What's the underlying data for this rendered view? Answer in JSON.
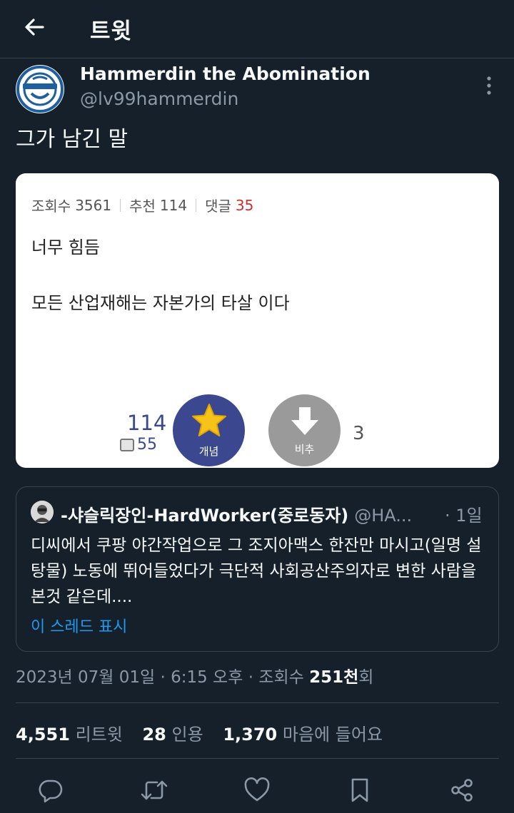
{
  "header": {
    "title": "트윗"
  },
  "author": {
    "name": "Hammerdin the Abomination",
    "handle": "@lv99hammerdin"
  },
  "tweet": {
    "text": "그가 남긴 말"
  },
  "embed": {
    "views_label": "조회수",
    "views": "3561",
    "recommend_label": "추천",
    "recommend": "114",
    "comments_label": "댓글",
    "comments": "35",
    "line1": "너무 힘듬",
    "line2": "모든 산업재해는 자본가의 타살 이다",
    "up_count": "114",
    "fix_count": "55",
    "up_label": "개념",
    "down_label": "비추",
    "down_count": "3",
    "colors": {
      "up_button": "#3b4890",
      "down_button": "#9a9a9a",
      "star": "#f6c419",
      "comments": "#d1302a"
    }
  },
  "quote": {
    "name": "-샤슬릭장인-HardWorker(중로동자)",
    "handle": "@HA...",
    "time": "· 1일",
    "body": "디씨에서 쿠팡 야간작업으로 그 조지아맥스 한잔만 마시고(일명 설탕물) 노동에 뛰어들었다가 극단적 사회공산주의자로 변한 사람을 본것 같은데....",
    "show_thread": "이 스레드 표시"
  },
  "meta": {
    "datetime": "2023년 07월 01일 · 6:15 오후 · 조회수 ",
    "views": "251천",
    "views_suffix": "회"
  },
  "counts": {
    "retweets": "4,551",
    "retweets_label": "리트윗",
    "quotes": "28",
    "quotes_label": "인용",
    "likes": "1,370",
    "likes_label": "마음에 들어요"
  },
  "actions": [
    "reply-icon",
    "retweet-icon",
    "like-icon",
    "bookmark-icon",
    "share-icon"
  ],
  "theme": {
    "background": "#15202b",
    "text": "#f7f9f9",
    "muted": "#8b98a5",
    "link": "#1d9bf0",
    "border": "#38444d"
  }
}
